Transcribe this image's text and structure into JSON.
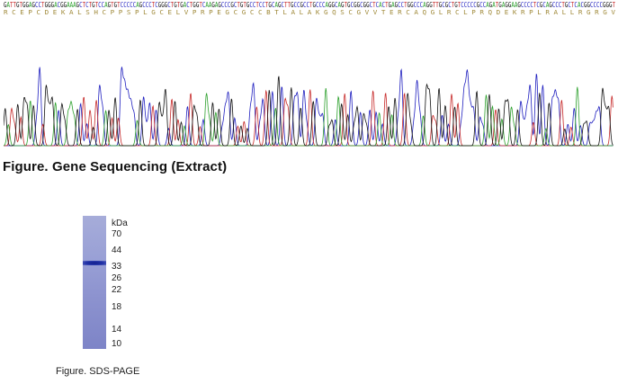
{
  "sequencing": {
    "nucleotides": "GATTGTGGAGCCTGGGACGGAAAGCTCTGTCCAGTGTCCCCCAGCCCTCGGGCTGTGACTGGTCAAGAGCCCGCTGTGCCTCCTGCAGCTTGCCGCCTGCCCAGGCAGTGCGGCGGCTCACTGAGCCTGGCCCAGGTTGCGCTGTCCCCCGCCAGATGAGGAAGCCCCTCGCAGCCCTGCTCACGGCCCCGGGT",
    "amino_acids": "R C E P C D E K A L S H C P P S P L G C E L V P R P E G C G C C B T L A L A K G Q S C G V V T E R C A Q G L R C L P R Q D E K R P L R A L L R G R G V",
    "caption": "Figure. Gene Sequencing (Extract)",
    "trace_colors": {
      "A": "#2ca02c",
      "C": "#1f1fbf",
      "G": "#111111",
      "T": "#c62828"
    }
  },
  "gel": {
    "unit_label": "kDa",
    "markers": [
      "70",
      "44",
      "33",
      "26",
      "22",
      "18",
      "14",
      "10"
    ],
    "caption": "Figure. SDS-PAGE"
  }
}
